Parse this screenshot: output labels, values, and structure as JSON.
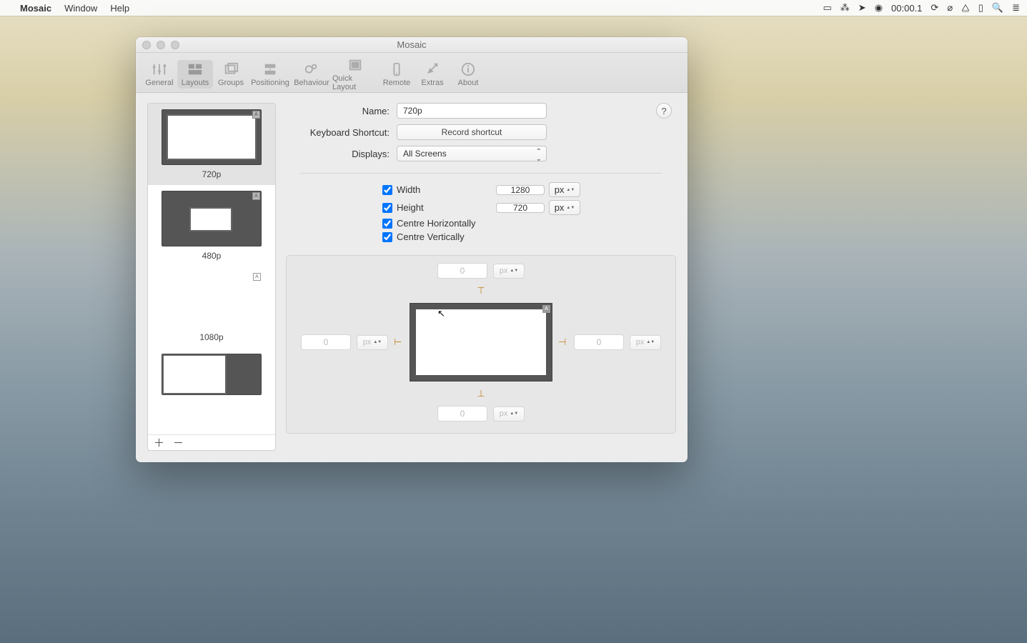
{
  "menubar": {
    "appname": "Mosaic",
    "items": [
      "Window",
      "Help"
    ],
    "clock": "00:00.1"
  },
  "window": {
    "title": "Mosaic",
    "toolbar": [
      {
        "label": "General"
      },
      {
        "label": "Layouts"
      },
      {
        "label": "Groups"
      },
      {
        "label": "Positioning"
      },
      {
        "label": "Behaviour"
      },
      {
        "label": "Quick Layout"
      },
      {
        "label": "Remote"
      },
      {
        "label": "Extras"
      },
      {
        "label": "About"
      }
    ]
  },
  "sidebar": {
    "items": [
      {
        "label": "720p"
      },
      {
        "label": "480p"
      },
      {
        "label": "1080p"
      }
    ]
  },
  "form": {
    "name_label": "Name:",
    "name_value": "720p",
    "shortcut_label": "Keyboard Shortcut:",
    "shortcut_button": "Record shortcut",
    "displays_label": "Displays:",
    "displays_value": "All Screens",
    "width_label": "Width",
    "width_value": "1280",
    "height_label": "Height",
    "height_value": "720",
    "unit_px": "px",
    "centre_h": "Centre Horizontally",
    "centre_v": "Centre Vertically"
  },
  "preview": {
    "margin_top": "0",
    "margin_bottom": "0",
    "margin_left": "0",
    "margin_right": "0",
    "unit": "px"
  },
  "help": "?"
}
